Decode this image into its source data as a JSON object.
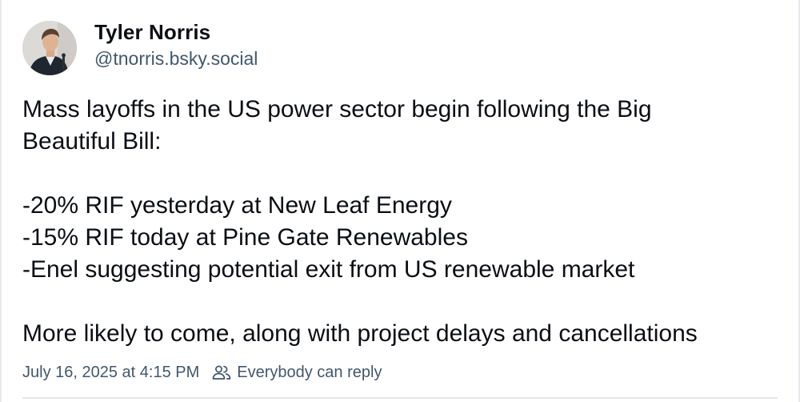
{
  "author": {
    "display_name": "Tyler Norris",
    "handle": "@tnorris.bsky.social",
    "avatar_icon": "avatar-photo"
  },
  "post": {
    "lines": [
      "Mass layoffs in the US power sector begin following the Big",
      "Beautiful Bill:",
      "",
      "-20% RIF yesterday at New Leaf Energy",
      "-15% RIF today at Pine Gate Renewables",
      "-Enel suggesting potential exit from US renewable market",
      "",
      "More likely to come, along with project delays and cancellations"
    ]
  },
  "meta": {
    "timestamp": "July 16, 2025 at 4:15 PM",
    "reply_setting": "Everybody can reply",
    "reply_icon": "people-icon"
  },
  "colors": {
    "text_primary": "#0b0f14",
    "text_secondary": "#42576c",
    "divider": "#e2e6ea"
  }
}
